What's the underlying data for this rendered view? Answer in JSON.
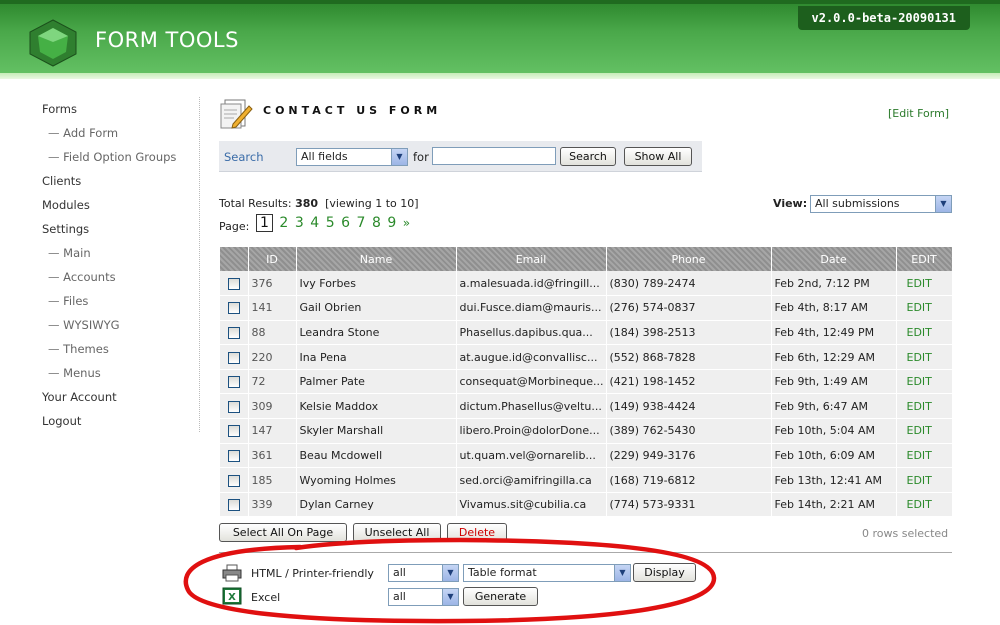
{
  "app": {
    "title": "FORM TOOLS",
    "version": "v2.0.0-beta-20090131"
  },
  "nav": [
    {
      "label": "Forms",
      "sub": false
    },
    {
      "label": "Add Form",
      "sub": true
    },
    {
      "label": "Field Option Groups",
      "sub": true
    },
    {
      "label": "Clients",
      "sub": false
    },
    {
      "label": "Modules",
      "sub": false
    },
    {
      "label": "Settings",
      "sub": false
    },
    {
      "label": "Main",
      "sub": true
    },
    {
      "label": "Accounts",
      "sub": true
    },
    {
      "label": "Files",
      "sub": true
    },
    {
      "label": "WYSIWYG",
      "sub": true
    },
    {
      "label": "Themes",
      "sub": true
    },
    {
      "label": "Menus",
      "sub": true
    },
    {
      "label": "Your Account",
      "sub": false
    },
    {
      "label": "Logout",
      "sub": false
    }
  ],
  "page": {
    "title": "CONTACT US FORM",
    "edit_form_link": "[Edit Form]"
  },
  "search": {
    "label": "Search",
    "field_select": "All fields",
    "for_label": "for",
    "query": "",
    "search_button": "Search",
    "show_all_button": "Show All"
  },
  "results": {
    "total_prefix": "Total Results:",
    "total": "380",
    "viewing": "[viewing 1 to 10]",
    "view_label": "View:",
    "view_select": "All submissions",
    "page_label": "Page:",
    "pages": [
      "1",
      "2",
      "3",
      "4",
      "5",
      "6",
      "7",
      "8",
      "9"
    ],
    "current_page": "1",
    "next": "»"
  },
  "table": {
    "headers": [
      "ID",
      "Name",
      "Email",
      "Phone",
      "Date",
      "EDIT"
    ],
    "rows": [
      {
        "id": "376",
        "name": "Ivy Forbes",
        "email": "a.malesuada.id@fringill...",
        "phone": "(830) 789-2474",
        "date": "Feb 2nd, 7:12 PM",
        "edit": "EDIT"
      },
      {
        "id": "141",
        "name": "Gail Obrien",
        "email": "dui.Fusce.diam@mauris...",
        "phone": "(276) 574-0837",
        "date": "Feb 4th, 8:17 AM",
        "edit": "EDIT"
      },
      {
        "id": "88",
        "name": "Leandra Stone",
        "email": "Phasellus.dapibus.qua...",
        "phone": "(184) 398-2513",
        "date": "Feb 4th, 12:49 PM",
        "edit": "EDIT"
      },
      {
        "id": "220",
        "name": "Ina Pena",
        "email": "at.augue.id@convallisc...",
        "phone": "(552) 868-7828",
        "date": "Feb 6th, 12:29 AM",
        "edit": "EDIT"
      },
      {
        "id": "72",
        "name": "Palmer Pate",
        "email": "consequat@Morbineque...",
        "phone": "(421) 198-1452",
        "date": "Feb 9th, 1:49 AM",
        "edit": "EDIT"
      },
      {
        "id": "309",
        "name": "Kelsie Maddox",
        "email": "dictum.Phasellus@veltu...",
        "phone": "(149) 938-4424",
        "date": "Feb 9th, 6:47 AM",
        "edit": "EDIT"
      },
      {
        "id": "147",
        "name": "Skyler Marshall",
        "email": "libero.Proin@dolorDone...",
        "phone": "(389) 762-5430",
        "date": "Feb 10th, 5:04 AM",
        "edit": "EDIT"
      },
      {
        "id": "361",
        "name": "Beau Mcdowell",
        "email": "ut.quam.vel@ornarelib...",
        "phone": "(229) 949-3176",
        "date": "Feb 10th, 6:09 AM",
        "edit": "EDIT"
      },
      {
        "id": "185",
        "name": "Wyoming Holmes",
        "email": "sed.orci@amifringilla.ca",
        "phone": "(168) 719-6812",
        "date": "Feb 13th, 12:41 AM",
        "edit": "EDIT"
      },
      {
        "id": "339",
        "name": "Dylan Carney",
        "email": "Vivamus.sit@cubilia.ca",
        "phone": "(774) 573-9331",
        "date": "Feb 14th, 2:21 AM",
        "edit": "EDIT"
      }
    ]
  },
  "actions": {
    "select_all": "Select All On Page",
    "unselect_all": "Unselect All",
    "delete": "Delete",
    "rows_selected": "0 rows selected"
  },
  "export": {
    "html": {
      "label": "HTML / Printer-friendly",
      "scope": "all",
      "format": "Table format",
      "button": "Display"
    },
    "excel": {
      "label": "Excel",
      "scope": "all",
      "button": "Generate"
    }
  },
  "colors": {
    "brand_green": "#4aa84a",
    "link_green": "#2b8a2b",
    "delete_red": "#cc0000",
    "annotation_red": "#e01010"
  }
}
